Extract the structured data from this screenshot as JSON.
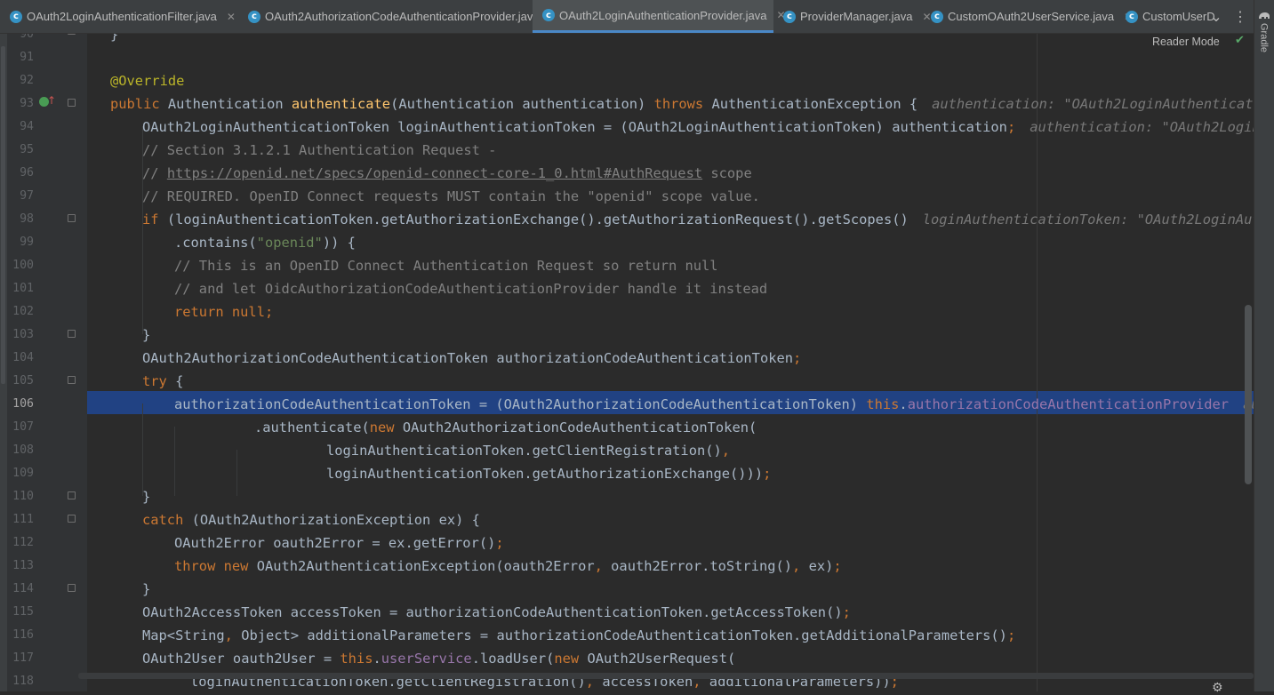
{
  "tabs": [
    {
      "name": "OAuth2LoginAuthenticationFilter.java",
      "icon": "c",
      "active": false
    },
    {
      "name": "OAuth2AuthorizationCodeAuthenticationProvider.java",
      "icon": "c",
      "active": false
    },
    {
      "name": "OAuth2LoginAuthenticationProvider.java",
      "icon": "c",
      "active": true
    },
    {
      "name": "ProviderManager.java",
      "icon": "c",
      "active": false
    },
    {
      "name": "CustomOAuth2UserService.java",
      "icon": "c",
      "active": false
    },
    {
      "name": "CustomUserD",
      "icon": "c",
      "active": false
    }
  ],
  "tab_close_glyph": "✕",
  "tabs_dropdown_glyph": "⌄",
  "more_glyph": "⋮",
  "toolwindow": {
    "gradle_label": "Gradle",
    "gradle_icon": "elephant-icon"
  },
  "reader_mode_label": "Reader Mode",
  "inspection_status_glyph": "✔",
  "status_gear_glyph": "⚙",
  "current_line": 106,
  "lines": [
    {
      "n": "90",
      "t": "}"
    },
    {
      "n": "91",
      "t": ""
    },
    {
      "n": "92",
      "t": "@Override"
    },
    {
      "n": "93",
      "t": "public Authentication authenticate(Authentication authentication) throws AuthenticationException {",
      "hint": "authentication: \"OAuth2LoginAuthentication"
    },
    {
      "n": "94",
      "t": "OAuth2LoginAuthenticationToken loginAuthenticationToken = (OAuth2LoginAuthenticationToken) authentication;",
      "hint": "authentication: \"OAuth2LoginAut"
    },
    {
      "n": "95",
      "t": "// Section 3.1.2.1 Authentication Request -"
    },
    {
      "n": "96",
      "t": "// https://openid.net/specs/openid-connect-core-1_0.html#AuthRequest scope",
      "url": "https://openid.net/specs/openid-connect-core-1_0.html#AuthRequest"
    },
    {
      "n": "97",
      "t": "// REQUIRED. OpenID Connect requests MUST contain the \"openid\" scope value."
    },
    {
      "n": "98",
      "t": "if (loginAuthenticationToken.getAuthorizationExchange().getAuthorizationRequest().getScopes()",
      "hint": "loginAuthenticationToken: \"OAuth2LoginAuther"
    },
    {
      "n": "99",
      "t": ".contains(\"openid\")) {"
    },
    {
      "n": "100",
      "t": "// This is an OpenID Connect Authentication Request so return null"
    },
    {
      "n": "101",
      "t": "// and let OidcAuthorizationCodeAuthenticationProvider handle it instead"
    },
    {
      "n": "102",
      "t": "return null;"
    },
    {
      "n": "103",
      "t": "}"
    },
    {
      "n": "104",
      "t": "OAuth2AuthorizationCodeAuthenticationToken authorizationCodeAuthenticationToken;"
    },
    {
      "n": "105",
      "t": "try {"
    },
    {
      "n": "106",
      "t": "authorizationCodeAuthenticationToken = (OAuth2AuthorizationCodeAuthenticationToken) this.authorizationCodeAuthenticationProvider",
      "hint": "authe"
    },
    {
      "n": "107",
      "t": ".authenticate(new OAuth2AuthorizationCodeAuthenticationToken("
    },
    {
      "n": "108",
      "t": "loginAuthenticationToken.getClientRegistration(),"
    },
    {
      "n": "109",
      "t": "loginAuthenticationToken.getAuthorizationExchange()));"
    },
    {
      "n": "110",
      "t": "}"
    },
    {
      "n": "111",
      "t": "catch (OAuth2AuthorizationException ex) {"
    },
    {
      "n": "112",
      "t": "OAuth2Error oauth2Error = ex.getError();"
    },
    {
      "n": "113",
      "t": "throw new OAuth2AuthenticationException(oauth2Error, oauth2Error.toString(), ex);"
    },
    {
      "n": "114",
      "t": "}"
    },
    {
      "n": "115",
      "t": "OAuth2AccessToken accessToken = authorizationCodeAuthenticationToken.getAccessToken();"
    },
    {
      "n": "116",
      "t": "Map<String, Object> additionalParameters = authorizationCodeAuthenticationToken.getAdditionalParameters();"
    },
    {
      "n": "117",
      "t": "OAuth2User oauth2User = this.userService.loadUser(new OAuth2UserRequest("
    },
    {
      "n": "118",
      "t": "loginAuthenticationToken.getClientRegistration(), accessToken, additionalParameters));"
    }
  ],
  "colors": {
    "editor_bg": "#2b2b2b",
    "keyword": "#cc7832",
    "function": "#ffc66d",
    "comment": "#808080",
    "string": "#6a8759",
    "annotation": "#bbb529",
    "field": "#9876aa",
    "selection": "#214283"
  }
}
